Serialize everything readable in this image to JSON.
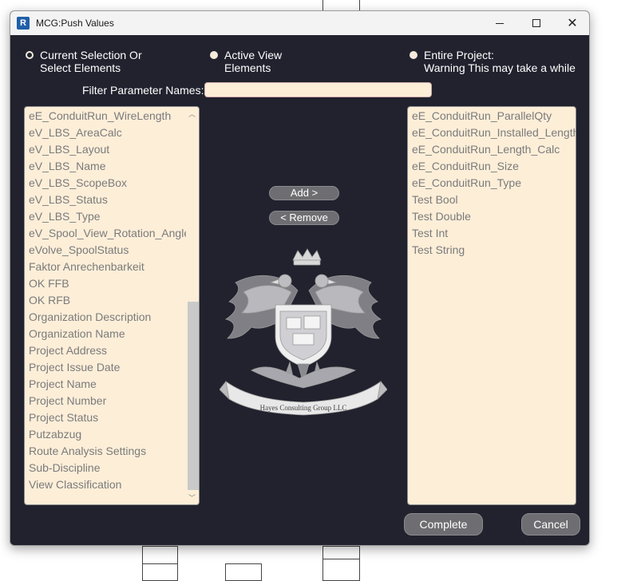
{
  "window": {
    "title": "MCG:Push Values",
    "app_icon_letter": "R"
  },
  "scope_options": [
    {
      "line1": "Current Selection Or",
      "line2": "Select Elements",
      "selected": false
    },
    {
      "line1": "Active View",
      "line2": "Elements",
      "selected": true
    },
    {
      "line1": "Entire Project:",
      "line2": "Warning This may take a while",
      "selected": true
    }
  ],
  "filter": {
    "label": "Filter Parameter Names:",
    "value": "",
    "placeholder": ""
  },
  "available_parameters": [
    "eE_ConduitRun_WireLength",
    "eV_LBS_AreaCalc",
    "eV_LBS_Layout",
    "eV_LBS_Name",
    "eV_LBS_ScopeBox",
    "eV_LBS_Status",
    "eV_LBS_Type",
    "eV_Spool_View_Rotation_Angle",
    "eVolve_SpoolStatus",
    "Faktor Anrechenbarkeit",
    "OK FFB",
    "OK RFB",
    "Organization Description",
    "Organization Name",
    "Project Address",
    "Project Issue Date",
    "Project Name",
    "Project Number",
    "Project Status",
    "Putzabzug",
    "Route Analysis Settings",
    "Sub-Discipline",
    "View Classification"
  ],
  "selected_parameters": [
    "eE_ConduitRun_ParallelQty",
    "eE_ConduitRun_Installed_Length",
    "eE_ConduitRun_Length_Calc",
    "eE_ConduitRun_Size",
    "eE_ConduitRun_Type",
    "Test Bool",
    "Test Double",
    "Test Int",
    "Test String"
  ],
  "buttons": {
    "add": "Add >",
    "remove": "< Remove",
    "complete": "Complete",
    "cancel": "Cancel"
  },
  "colors": {
    "background": "#21222e",
    "list_background": "#fdeed8",
    "list_text": "#7b7b7b",
    "button": "#6e6e72"
  },
  "logo": {
    "text": "Hayes Consulting Group LLC",
    "icon": "double-headed-eagle-crest"
  }
}
